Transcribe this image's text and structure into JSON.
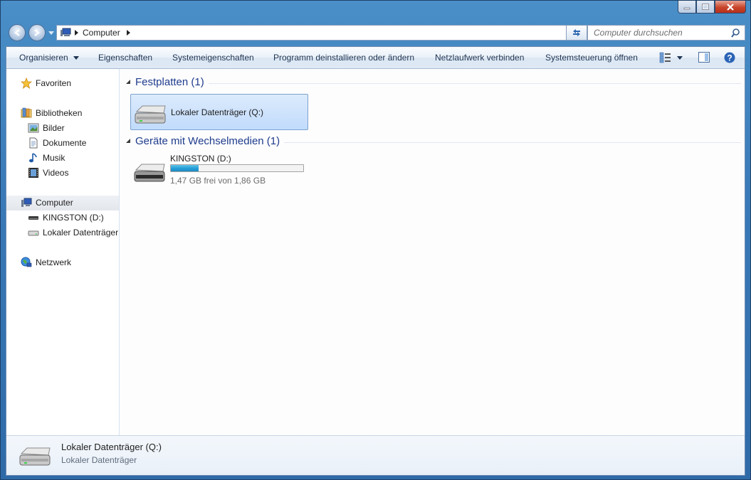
{
  "window": {
    "caption_buttons": [
      "minimize",
      "maximize",
      "close"
    ]
  },
  "address_bar": {
    "crumbs": [
      "Computer"
    ]
  },
  "search": {
    "placeholder": "Computer durchsuchen"
  },
  "toolbar": {
    "organize": "Organisieren",
    "properties": "Eigenschaften",
    "system_properties": "Systemeigenschaften",
    "uninstall": "Programm deinstallieren oder ändern",
    "map_drive": "Netzlaufwerk verbinden",
    "control_panel": "Systemsteuerung öffnen"
  },
  "sidebar": {
    "favorites": "Favoriten",
    "libraries": "Bibliotheken",
    "library_items": [
      "Bilder",
      "Dokumente",
      "Musik",
      "Videos"
    ],
    "computer": "Computer",
    "computer_items": [
      "KINGSTON (D:)",
      "Lokaler Datenträger"
    ],
    "network": "Netzwerk"
  },
  "groups": {
    "hard_disks": {
      "title": "Festplatten (1)",
      "items": [
        {
          "name": "Lokaler Datenträger (Q:)"
        }
      ]
    },
    "removable": {
      "title": "Geräte mit Wechselmedien (1)",
      "items": [
        {
          "name": "KINGSTON (D:)",
          "free_text": "1,47 GB frei von 1,86 GB",
          "used_fraction": 0.21
        }
      ]
    }
  },
  "details_pane": {
    "title": "Lokaler Datenträger (Q:)",
    "subtitle": "Lokaler Datenträger"
  },
  "colors": {
    "accent": "#1e3c8c",
    "bar_fill": "#26a0da",
    "selection": "#c1dbfc"
  }
}
